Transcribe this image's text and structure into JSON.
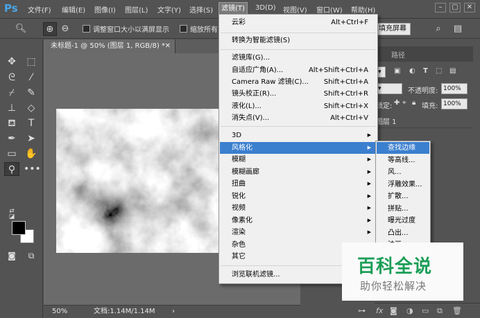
{
  "app": {
    "logo": "Ps"
  },
  "menubar": {
    "items": [
      "文件(F)",
      "编辑(E)",
      "图像(I)",
      "图层(L)",
      "文字(Y)",
      "选择(S)",
      "滤镜(T)",
      "3D(D)",
      "视图(V)",
      "窗口(W)",
      "帮助(H)"
    ],
    "active_index": 6,
    "window_controls": [
      "–",
      "▢",
      "✕"
    ]
  },
  "options_bar": {
    "resize_windows_label": "调整窗口大小以满屏显示",
    "zoom_all_label": "缩放所有",
    "fill_screen_button": "填充屏幕"
  },
  "document": {
    "tab_title": "未标题-1 @ 50% (图层 1, RGB/8) *",
    "zoom": "50%",
    "doc_info": "文档:1.14M/1.14M"
  },
  "panels": {
    "tab_paths": "路径",
    "opacity_label": "不透明度:",
    "opacity_value": "100%",
    "lock_label": "锁定:",
    "fill_label": "填充:",
    "fill_value": "100%",
    "layer_name": "图层 1"
  },
  "filter_menu": {
    "sections": [
      [
        {
          "label": "云彩",
          "shortcut": "Alt+Ctrl+F"
        }
      ],
      [
        {
          "label": "转换为智能滤镜(S)",
          "shortcut": ""
        }
      ],
      [
        {
          "label": "滤镜库(G)...",
          "shortcut": ""
        },
        {
          "label": "自适应广角(A)...",
          "shortcut": "Alt+Shift+Ctrl+A"
        },
        {
          "label": "Camera Raw 滤镜(C)...",
          "shortcut": "Shift+Ctrl+A"
        },
        {
          "label": "镜头校正(R)...",
          "shortcut": "Shift+Ctrl+R"
        },
        {
          "label": "液化(L)...",
          "shortcut": "Shift+Ctrl+X"
        },
        {
          "label": "消失点(V)...",
          "shortcut": "Alt+Ctrl+V"
        }
      ],
      [
        {
          "label": "3D",
          "submenu": true
        },
        {
          "label": "风格化",
          "submenu": true,
          "highlighted": true
        },
        {
          "label": "模糊",
          "submenu": true
        },
        {
          "label": "模糊画廊",
          "submenu": true
        },
        {
          "label": "扭曲",
          "submenu": true
        },
        {
          "label": "锐化",
          "submenu": true
        },
        {
          "label": "视频",
          "submenu": true
        },
        {
          "label": "像素化",
          "submenu": true
        },
        {
          "label": "渲染",
          "submenu": true
        },
        {
          "label": "杂色",
          "submenu": true
        },
        {
          "label": "其它",
          "submenu": true
        }
      ],
      [
        {
          "label": "浏览联机滤镜...",
          "shortcut": ""
        }
      ]
    ]
  },
  "stylize_submenu": {
    "items": [
      "查找边缘",
      "等高线...",
      "风...",
      "浮雕效果...",
      "扩散...",
      "拼贴...",
      "曝光过度",
      "凸出...",
      "油画..."
    ],
    "highlighted_index": 0
  },
  "watermark": {
    "title": "百科全说",
    "subtitle": "助你轻松解决"
  },
  "colors": {
    "ui_bg": "#535353",
    "menu_bg": "#f0f0f0",
    "menu_highlight": "#3b7fcf",
    "ps_logo": "#4aa5e8",
    "watermark_green": "#1b9e57",
    "foreground_swatch": "#000000",
    "background_swatch": "#ffffff"
  }
}
